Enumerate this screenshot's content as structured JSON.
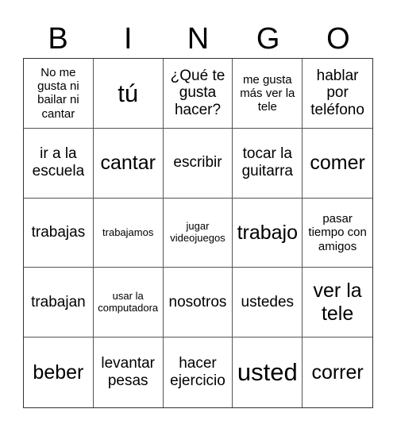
{
  "header": [
    "B",
    "I",
    "N",
    "G",
    "O"
  ],
  "cells": [
    "No me gusta ni bailar ni cantar",
    "tú",
    "¿Qué te gusta hacer?",
    "me gusta más ver la tele",
    "hablar por teléfono",
    "ir a la escuela",
    "cantar",
    "escribir",
    "tocar la guitarra",
    "comer",
    "trabajas",
    "trabajamos",
    "jugar videojuegos",
    "trabajo",
    "pasar tiempo con amigos",
    "trabajan",
    "usar la computadora",
    "nosotros",
    "ustedes",
    "ver la tele",
    "beber",
    "levantar pesas",
    "hacer ejercicio",
    "usted",
    "correr"
  ]
}
